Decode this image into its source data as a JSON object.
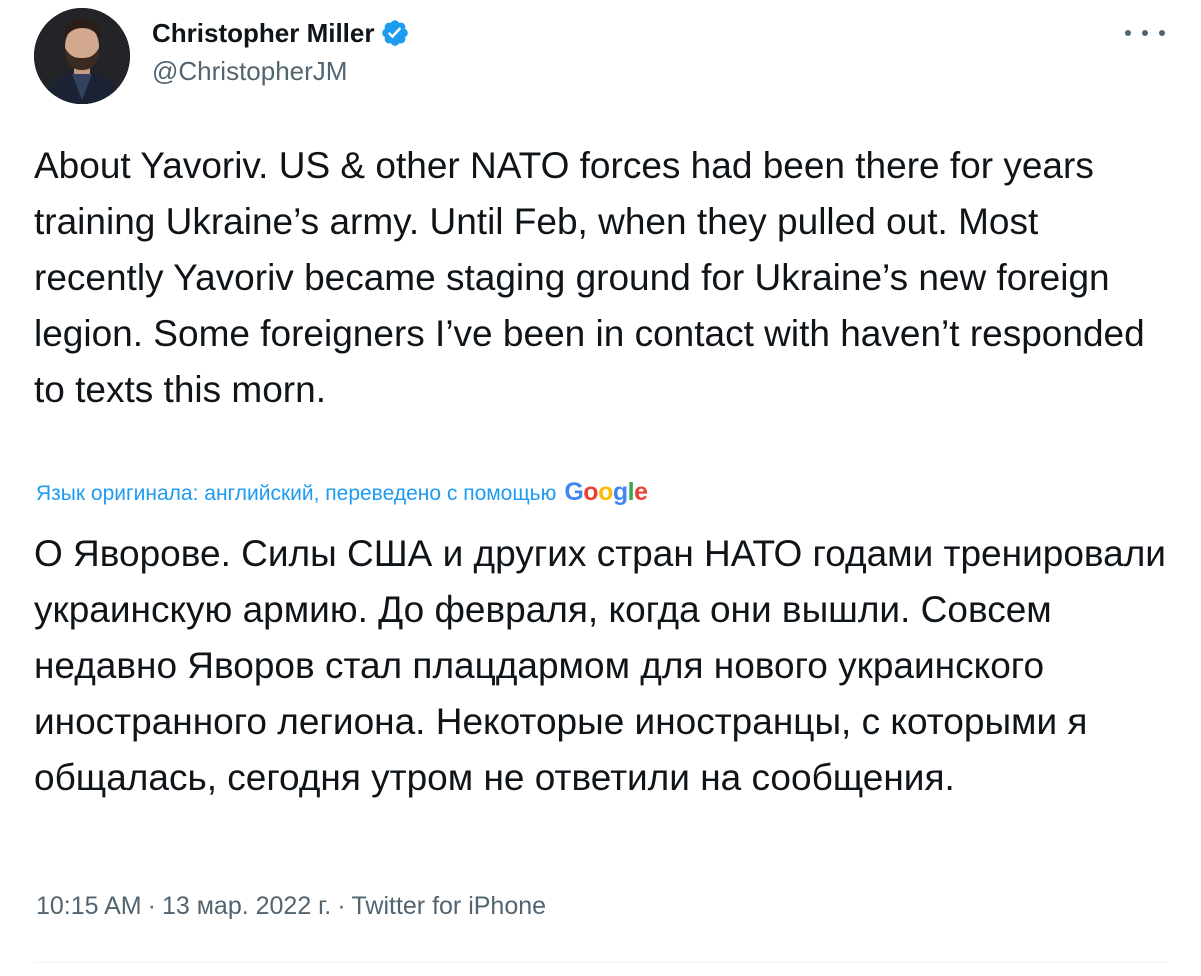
{
  "author": {
    "display_name": "Christopher Miller",
    "handle": "@ChristopherJM",
    "verified": true
  },
  "tweet": {
    "text": "About Yavoriv. US & other NATO forces had been there for years training Ukraine’s army. Until Feb, when they pulled out. Most recently Yavoriv became staging ground for Ukraine’s new foreign legion. Some foreigners I’ve been in contact with haven’t responded to texts this morn.",
    "translation_note": "Язык оригинала: английский, переведено с помощью",
    "translation_provider": "Google",
    "translated_text": "О Яворове. Силы США и других стран НАТО годами тренировали украинскую армию. До февраля, когда они вышли. Совсем недавно Яворов стал плацдармом для нового украинского иностранного легиона. Некоторые иностранцы, с которыми я общалась, сегодня утром не ответили на сообщения.",
    "time": "10:15 AM",
    "date": "13 мар. 2022 г.",
    "source": "Twitter for iPhone"
  },
  "colors": {
    "text": "#0f1419",
    "secondary": "#536471",
    "accent": "#1d9bf0"
  },
  "icons": {
    "verified": "verified-badge-icon",
    "more": "more-options-icon"
  }
}
